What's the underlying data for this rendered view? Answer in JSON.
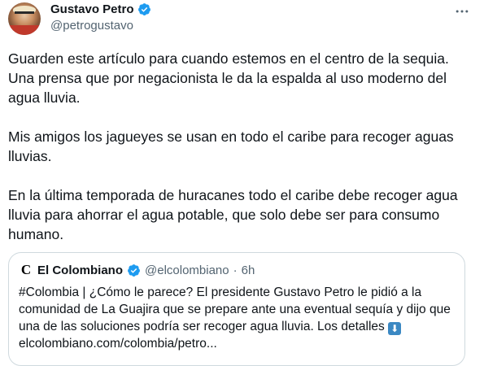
{
  "tweet": {
    "author_name": "Gustavo Petro",
    "author_handle": "@petrogustavo",
    "paragraphs": [
      "Guarden este artículo para cuando estemos en el centro de la sequia.\nUna prensa que por negacionista le da la espalda al uso moderno del\nagua lluvia.",
      "Mis amigos los jagueyes se usan en todo el caribe para recoger aguas\nlluvias.",
      "En la última temporada de huracanes todo el caribe debe recoger agua\nlluvia para ahorrar el agua potable, que solo debe ser para consumo\nhumano."
    ]
  },
  "quote": {
    "logo_letter": "C",
    "author_name": "El Colombiano",
    "author_handle": "@elcolombiano",
    "separator": "·",
    "time": "6h",
    "text": "#Colombia | ¿Cómo le parece? El presidente Gustavo Petro le pidió a la\ncomunidad de La Guajira que se prepare ante una eventual sequía y dijo que\nuna de las soluciones podría ser recoger agua lluvia. Los detalles",
    "link": "elcolombiano.com/colombia/petro..."
  },
  "colors": {
    "verified": "#1d9bf0",
    "muted": "#536471",
    "border": "#cfd9de"
  }
}
